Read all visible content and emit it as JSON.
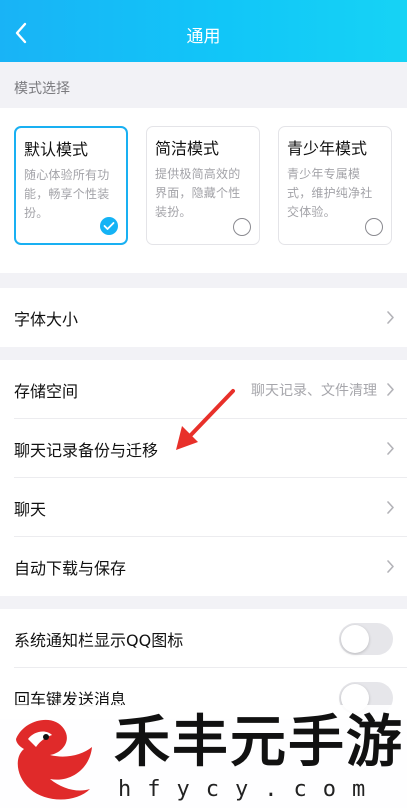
{
  "header": {
    "title": "通用"
  },
  "mode_section": {
    "label": "模式选择",
    "modes": [
      {
        "title": "默认模式",
        "desc": "随心体验所有功能，畅享个性装扮。",
        "selected": true
      },
      {
        "title": "简洁模式",
        "desc": "提供极简高效的界面，隐藏个性装扮。",
        "selected": false
      },
      {
        "title": "青少年模式",
        "desc": "青少年专属模式，维护纯净社交体验。",
        "selected": false
      }
    ]
  },
  "settings": {
    "font_size": "字体大小",
    "storage": "存储空间",
    "storage_extra": "聊天记录、文件清理",
    "chat_backup": "聊天记录备份与迁移",
    "chat": "聊天",
    "auto_download": "自动下载与保存",
    "notif_qq_icon": "系统通知栏显示QQ图标",
    "enter_send": "回车键发送消息"
  },
  "toggles": {
    "notif_qq_icon": false,
    "enter_send": false
  },
  "watermark": {
    "name": "禾丰元手游",
    "domain": "hfycy.com"
  },
  "colors": {
    "accent": "#15b3f5",
    "header_start": "#19b3f6",
    "header_end": "#16d3f5",
    "arrow": "#e8302a"
  }
}
